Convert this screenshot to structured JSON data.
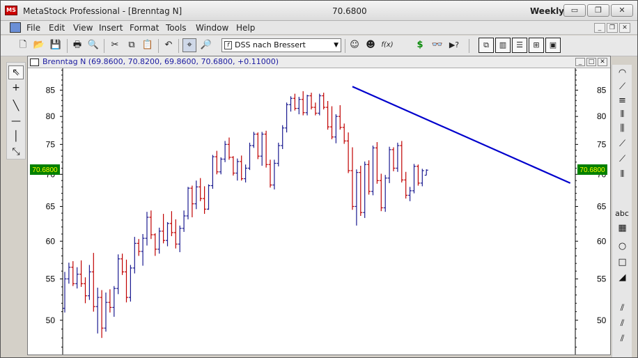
{
  "window": {
    "app_title": "MetaStock Professional - [Brenntag N]",
    "price": "70.6800",
    "period": "Weekly",
    "controls": {
      "minimize": "▭",
      "restore": "❐",
      "close": "✕"
    }
  },
  "menu": {
    "items": [
      "File",
      "Edit",
      "View",
      "Insert",
      "Format",
      "Tools",
      "Window",
      "Help"
    ],
    "mdi_controls": {
      "minimize": "_",
      "restore": "❐",
      "close": "✕"
    }
  },
  "toolbar": {
    "template_icon": "f",
    "template_select": "DSS nach Bressert",
    "template_arrow": "▼",
    "icons": {
      "new": "🗋",
      "open": "📂",
      "save": "💾",
      "print": "🖶",
      "print_preview": "🔍",
      "cut": "✂",
      "copy": "⧉",
      "paste": "📋",
      "undo": "↶",
      "crosshair": "⌖",
      "zoom": "🔎",
      "expert": "☺",
      "explorer": "☻",
      "indicator": "f(x)",
      "system": "$",
      "binoculars": "👓",
      "help": "▶?",
      "cascade": "⧉",
      "tile_vertical": "▥",
      "tile_horizontal": "☰",
      "tile_grid": "⊞",
      "fit": "▣"
    }
  },
  "left_tools": [
    "⇖",
    "+",
    "╲",
    "—",
    "│",
    "⤡"
  ],
  "right_tools": [
    "◠",
    "⟋",
    "≡",
    "⦀",
    "⫼",
    "⟋",
    "⟋",
    "⦀",
    "abc",
    "▦",
    "○",
    "□",
    "◢",
    "⫽",
    "⫽",
    "⫽"
  ],
  "chart_window": {
    "title": "Brenntag N (69.8600, 70.8200, 69.8600, 70.6800, +0.11000)",
    "controls": {
      "minimize": "_",
      "maximize": "□",
      "close": "✕"
    },
    "price_badge": "70.6800"
  },
  "chart_data": {
    "type": "ohlc",
    "title": "Brenntag N",
    "period": "Weekly",
    "y_axis": {
      "scale": "log",
      "ticks": [
        50,
        55,
        60,
        65,
        70,
        75,
        80,
        85
      ],
      "labels": [
        "50",
        "55",
        "60",
        "65",
        "70",
        "75",
        "80",
        "85"
      ],
      "visible_range": [
        46.2,
        89.4
      ]
    },
    "last_price": 70.68,
    "colors": {
      "up": "#1a1a90",
      "down": "#c00000",
      "trendline": "#0000cc",
      "price_badge_bg": "#008000",
      "price_badge_text": "#ffff00"
    },
    "trendline": {
      "from": {
        "bar": 70,
        "price": 85.7
      },
      "to": {
        "bar": 123,
        "price": 68.6
      }
    },
    "bars": [
      {
        "o": 51.4,
        "h": 55.9,
        "l": 50.9,
        "c": 55.0
      },
      {
        "o": 55.0,
        "h": 57.1,
        "l": 54.4,
        "c": 56.5
      },
      {
        "o": 56.5,
        "h": 57.3,
        "l": 54.1,
        "c": 54.4
      },
      {
        "o": 54.4,
        "h": 56.5,
        "l": 53.8,
        "c": 55.6
      },
      {
        "o": 55.6,
        "h": 57.4,
        "l": 54.0,
        "c": 54.4
      },
      {
        "o": 54.4,
        "h": 55.2,
        "l": 52.0,
        "c": 52.9
      },
      {
        "o": 52.9,
        "h": 56.8,
        "l": 52.4,
        "c": 55.9
      },
      {
        "o": 55.9,
        "h": 58.4,
        "l": 51.0,
        "c": 51.6
      },
      {
        "o": 51.6,
        "h": 53.9,
        "l": 48.5,
        "c": 52.7
      },
      {
        "o": 52.7,
        "h": 53.6,
        "l": 48.0,
        "c": 49.1
      },
      {
        "o": 49.1,
        "h": 53.3,
        "l": 48.7,
        "c": 52.1
      },
      {
        "o": 52.1,
        "h": 53.7,
        "l": 50.9,
        "c": 51.5
      },
      {
        "o": 51.5,
        "h": 54.1,
        "l": 50.4,
        "c": 53.8
      },
      {
        "o": 53.8,
        "h": 58.2,
        "l": 53.1,
        "c": 57.6
      },
      {
        "o": 57.6,
        "h": 58.3,
        "l": 55.5,
        "c": 55.9
      },
      {
        "o": 55.9,
        "h": 57.5,
        "l": 52.1,
        "c": 52.7
      },
      {
        "o": 52.7,
        "h": 56.8,
        "l": 52.2,
        "c": 56.4
      },
      {
        "o": 56.4,
        "h": 60.6,
        "l": 55.7,
        "c": 59.7
      },
      {
        "o": 59.7,
        "h": 60.3,
        "l": 58.0,
        "c": 58.6
      },
      {
        "o": 58.6,
        "h": 61.0,
        "l": 56.7,
        "c": 60.4
      },
      {
        "o": 60.4,
        "h": 64.2,
        "l": 59.4,
        "c": 63.4
      },
      {
        "o": 63.4,
        "h": 64.4,
        "l": 60.3,
        "c": 60.9
      },
      {
        "o": 60.9,
        "h": 61.1,
        "l": 58.0,
        "c": 58.9
      },
      {
        "o": 58.9,
        "h": 61.9,
        "l": 58.3,
        "c": 61.4
      },
      {
        "o": 61.4,
        "h": 63.9,
        "l": 59.7,
        "c": 60.1
      },
      {
        "o": 60.1,
        "h": 62.7,
        "l": 59.3,
        "c": 62.5
      },
      {
        "o": 62.5,
        "h": 64.3,
        "l": 60.7,
        "c": 61.2
      },
      {
        "o": 61.2,
        "h": 63.1,
        "l": 59.0,
        "c": 59.6
      },
      {
        "o": 59.6,
        "h": 62.2,
        "l": 58.5,
        "c": 61.8
      },
      {
        "o": 61.8,
        "h": 64.4,
        "l": 61.3,
        "c": 63.6
      },
      {
        "o": 63.6,
        "h": 68.0,
        "l": 63.1,
        "c": 67.8
      },
      {
        "o": 67.8,
        "h": 68.2,
        "l": 63.4,
        "c": 65.4
      },
      {
        "o": 65.4,
        "h": 69.0,
        "l": 64.6,
        "c": 68.0
      },
      {
        "o": 68.0,
        "h": 69.4,
        "l": 65.8,
        "c": 66.2
      },
      {
        "o": 66.2,
        "h": 68.1,
        "l": 63.9,
        "c": 64.6
      },
      {
        "o": 64.6,
        "h": 68.4,
        "l": 64.5,
        "c": 68.2
      },
      {
        "o": 68.2,
        "h": 73.2,
        "l": 67.7,
        "c": 72.9
      },
      {
        "o": 72.9,
        "h": 73.9,
        "l": 70.0,
        "c": 70.4
      },
      {
        "o": 70.4,
        "h": 72.8,
        "l": 70.0,
        "c": 72.5
      },
      {
        "o": 72.5,
        "h": 75.6,
        "l": 72.0,
        "c": 75.0
      },
      {
        "o": 75.0,
        "h": 76.2,
        "l": 72.4,
        "c": 72.8
      },
      {
        "o": 72.8,
        "h": 73.0,
        "l": 69.8,
        "c": 70.2
      },
      {
        "o": 70.2,
        "h": 72.6,
        "l": 69.0,
        "c": 72.1
      },
      {
        "o": 72.1,
        "h": 73.1,
        "l": 69.0,
        "c": 69.3
      },
      {
        "o": 69.3,
        "h": 71.6,
        "l": 68.7,
        "c": 71.0
      },
      {
        "o": 71.0,
        "h": 75.3,
        "l": 70.7,
        "c": 74.8
      },
      {
        "o": 74.8,
        "h": 77.2,
        "l": 74.4,
        "c": 76.8
      },
      {
        "o": 76.8,
        "h": 77.1,
        "l": 72.5,
        "c": 73.0
      },
      {
        "o": 73.0,
        "h": 77.2,
        "l": 71.4,
        "c": 76.8
      },
      {
        "o": 76.8,
        "h": 77.4,
        "l": 71.1,
        "c": 71.6
      },
      {
        "o": 71.6,
        "h": 72.4,
        "l": 67.9,
        "c": 68.3
      },
      {
        "o": 68.3,
        "h": 72.4,
        "l": 67.6,
        "c": 71.8
      },
      {
        "o": 71.8,
        "h": 75.3,
        "l": 71.3,
        "c": 74.8
      },
      {
        "o": 74.8,
        "h": 78.4,
        "l": 74.2,
        "c": 77.9
      },
      {
        "o": 77.9,
        "h": 82.6,
        "l": 77.1,
        "c": 82.2
      },
      {
        "o": 82.2,
        "h": 83.8,
        "l": 80.9,
        "c": 83.4
      },
      {
        "o": 83.4,
        "h": 84.3,
        "l": 81.1,
        "c": 81.5
      },
      {
        "o": 81.5,
        "h": 83.7,
        "l": 80.4,
        "c": 83.2
      },
      {
        "o": 83.2,
        "h": 84.8,
        "l": 80.2,
        "c": 80.7
      },
      {
        "o": 80.7,
        "h": 84.1,
        "l": 80.2,
        "c": 83.9
      },
      {
        "o": 83.9,
        "h": 84.5,
        "l": 81.3,
        "c": 81.7
      },
      {
        "o": 81.7,
        "h": 82.6,
        "l": 80.2,
        "c": 80.6
      },
      {
        "o": 80.6,
        "h": 84.3,
        "l": 80.2,
        "c": 83.9
      },
      {
        "o": 83.9,
        "h": 84.5,
        "l": 81.3,
        "c": 81.7
      },
      {
        "o": 81.7,
        "h": 82.9,
        "l": 77.6,
        "c": 78.1
      },
      {
        "o": 78.1,
        "h": 81.9,
        "l": 75.9,
        "c": 76.3
      },
      {
        "o": 76.3,
        "h": 80.4,
        "l": 75.2,
        "c": 80.0
      },
      {
        "o": 80.0,
        "h": 82.1,
        "l": 77.6,
        "c": 78.0
      },
      {
        "o": 78.0,
        "h": 78.7,
        "l": 75.1,
        "c": 75.6
      },
      {
        "o": 75.6,
        "h": 77.1,
        "l": 70.2,
        "c": 70.6
      },
      {
        "o": 70.6,
        "h": 74.5,
        "l": 64.5,
        "c": 65.0
      },
      {
        "o": 65.0,
        "h": 70.8,
        "l": 62.2,
        "c": 70.3
      },
      {
        "o": 70.3,
        "h": 71.4,
        "l": 63.6,
        "c": 64.1
      },
      {
        "o": 64.1,
        "h": 72.1,
        "l": 63.3,
        "c": 71.6
      },
      {
        "o": 71.6,
        "h": 72.3,
        "l": 66.8,
        "c": 67.3
      },
      {
        "o": 67.3,
        "h": 74.8,
        "l": 66.7,
        "c": 74.4
      },
      {
        "o": 74.4,
        "h": 75.4,
        "l": 68.5,
        "c": 69.0
      },
      {
        "o": 69.0,
        "h": 70.1,
        "l": 64.3,
        "c": 64.8
      },
      {
        "o": 64.8,
        "h": 69.9,
        "l": 64.2,
        "c": 69.4
      },
      {
        "o": 69.4,
        "h": 74.6,
        "l": 68.6,
        "c": 74.1
      },
      {
        "o": 74.1,
        "h": 74.5,
        "l": 70.5,
        "c": 71.0
      },
      {
        "o": 71.0,
        "h": 75.3,
        "l": 70.4,
        "c": 74.8
      },
      {
        "o": 74.8,
        "h": 75.6,
        "l": 68.7,
        "c": 69.1
      },
      {
        "o": 69.1,
        "h": 70.4,
        "l": 66.2,
        "c": 66.7
      },
      {
        "o": 66.7,
        "h": 68.0,
        "l": 65.8,
        "c": 67.4
      },
      {
        "o": 67.4,
        "h": 71.7,
        "l": 67.0,
        "c": 71.3
      },
      {
        "o": 71.3,
        "h": 71.6,
        "l": 68.2,
        "c": 68.6
      },
      {
        "o": 68.6,
        "h": 70.9,
        "l": 68.1,
        "c": 70.6
      },
      {
        "o": 69.86,
        "h": 70.82,
        "l": 69.86,
        "c": 70.68
      }
    ]
  }
}
